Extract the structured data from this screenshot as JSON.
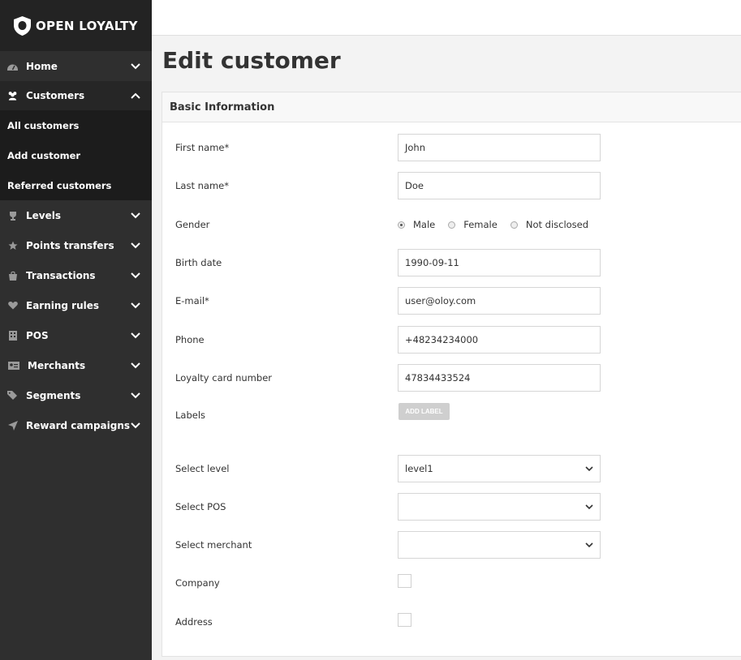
{
  "brand": {
    "name": "OPEN LOYALTY"
  },
  "sidebar": {
    "items": [
      {
        "label": "Home",
        "icon": "dashboard-icon"
      },
      {
        "label": "Customers",
        "icon": "users-icon",
        "expanded": true,
        "sub": [
          {
            "label": "All customers"
          },
          {
            "label": "Add customer"
          },
          {
            "label": "Referred customers"
          }
        ]
      },
      {
        "label": "Levels",
        "icon": "trophy-icon"
      },
      {
        "label": "Points transfers",
        "icon": "star-icon"
      },
      {
        "label": "Transactions",
        "icon": "bag-icon"
      },
      {
        "label": "Earning rules",
        "icon": "heart-icon"
      },
      {
        "label": "POS",
        "icon": "building-icon"
      },
      {
        "label": "Merchants",
        "icon": "id-card-icon"
      },
      {
        "label": "Segments",
        "icon": "tags-icon"
      },
      {
        "label": "Reward campaigns",
        "icon": "send-icon"
      }
    ]
  },
  "page": {
    "title": "Edit customer"
  },
  "panel": {
    "title": "Basic Information",
    "fields": {
      "first_name": {
        "label": "First name*",
        "value": "John"
      },
      "last_name": {
        "label": "Last name*",
        "value": "Doe"
      },
      "gender": {
        "label": "Gender",
        "options": [
          "Male",
          "Female",
          "Not disclosed"
        ],
        "selected": "Male"
      },
      "birth_date": {
        "label": "Birth date",
        "value": "1990-09-11"
      },
      "email": {
        "label": "E-mail*",
        "value": "user@oloy.com"
      },
      "phone": {
        "label": "Phone",
        "value": "+48234234000"
      },
      "loyalty_card": {
        "label": "Loyalty card number",
        "value": "47834433524"
      },
      "labels": {
        "label": "Labels",
        "button": "ADD LABEL"
      },
      "level": {
        "label": "Select level",
        "value": "level1"
      },
      "pos": {
        "label": "Select POS",
        "value": ""
      },
      "merchant": {
        "label": "Select merchant",
        "value": ""
      },
      "company": {
        "label": "Company"
      },
      "address": {
        "label": "Address"
      }
    }
  }
}
